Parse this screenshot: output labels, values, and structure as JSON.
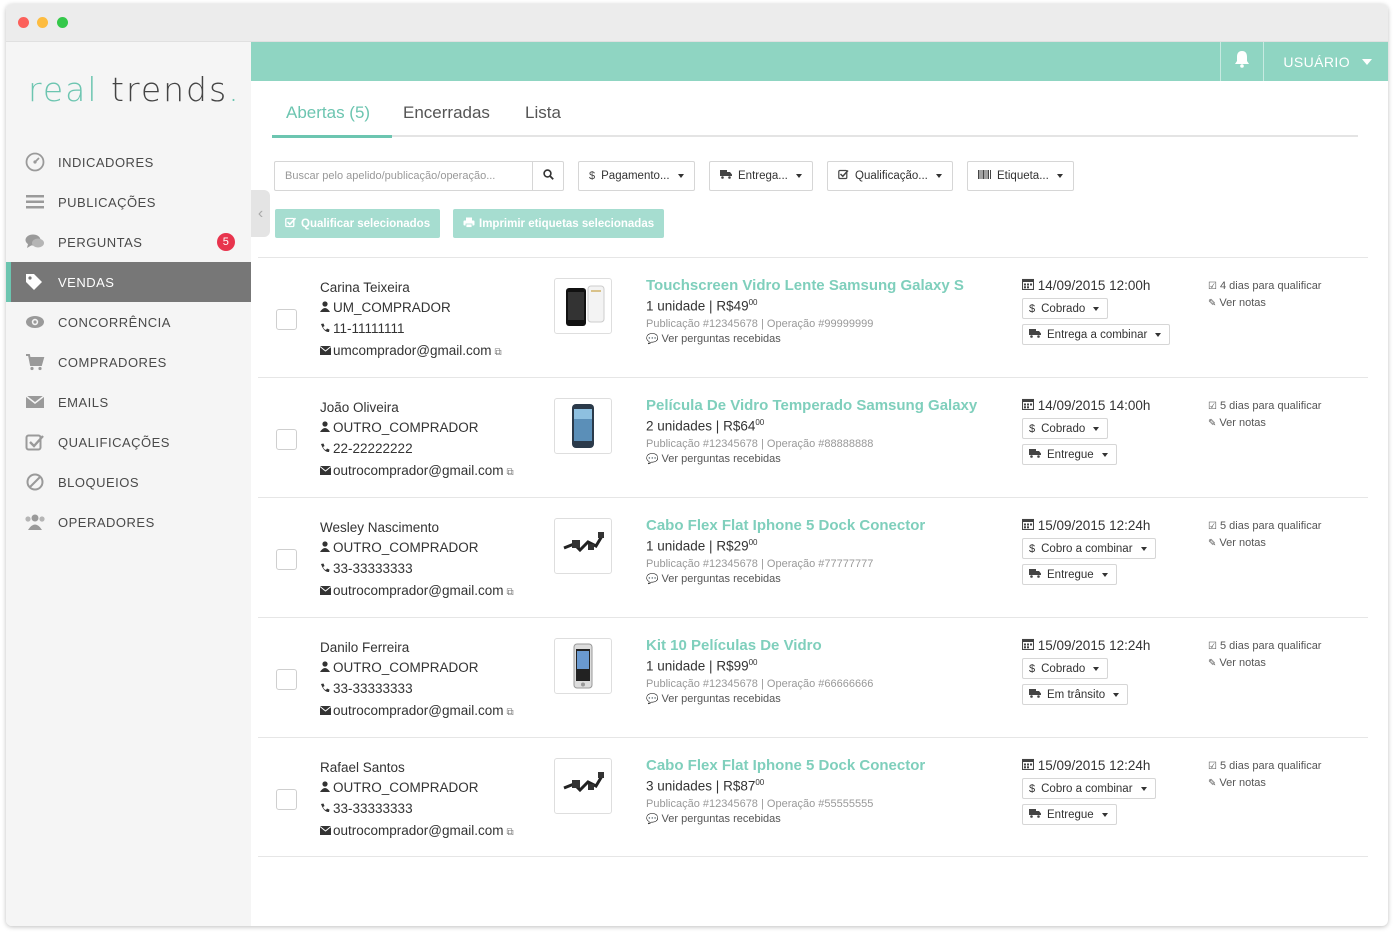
{
  "window": {
    "title_dots": [
      "close",
      "minimize",
      "maximize"
    ]
  },
  "logo": {
    "part1": "real",
    "part2": "trends",
    "part3": "."
  },
  "sidebar": {
    "items": [
      {
        "label": "INDICADORES",
        "icon": "gauge-icon"
      },
      {
        "label": "PUBLICAÇÕES",
        "icon": "list-icon"
      },
      {
        "label": "PERGUNTAS",
        "icon": "comments-icon",
        "badge": "5"
      },
      {
        "label": "VENDAS",
        "icon": "tags-icon",
        "active": true
      },
      {
        "label": "CONCORRÊNCIA",
        "icon": "eye-icon"
      },
      {
        "label": "COMPRADORES",
        "icon": "cart-icon"
      },
      {
        "label": "EMAILS",
        "icon": "envelope-icon"
      },
      {
        "label": "QUALIFICAÇÕES",
        "icon": "check-square-icon"
      },
      {
        "label": "BLOQUEIOS",
        "icon": "ban-icon"
      },
      {
        "label": "OPERADORES",
        "icon": "users-icon"
      }
    ]
  },
  "topbar": {
    "user_label": "USUÁRIO",
    "accent": "#8fd5c2"
  },
  "tabs": {
    "open": "Abertas (5)",
    "closed": "Encerradas",
    "list": "Lista"
  },
  "filters": {
    "search_placeholder": "Buscar pelo apelido/publicação/operação...",
    "payment": "Pagamento...",
    "delivery": "Entrega...",
    "qualification": "Qualificação...",
    "label": "Etiqueta..."
  },
  "actions": {
    "qualify": "Qualificar selecionados",
    "print": "Imprimir etiquetas selecionadas"
  },
  "sales": [
    {
      "buyer_name": "Carina Teixeira",
      "nickname": "UM_COMPRADOR",
      "phone": "11-11111111",
      "email": "umcomprador@gmail.com",
      "thumb": "phone-screen",
      "title": "Touchscreen Vidro Lente Samsung Galaxy S",
      "qty": "1 unidade | R$49",
      "cents": "00",
      "meta": "Publicação #12345678 | Operação #99999999",
      "questions": "Ver perguntas recebidas",
      "date": "14/09/2015 12:00h",
      "payment_status": "Cobrado",
      "delivery_status": "Entrega a combinar",
      "qualify": "4 dias para qualificar",
      "notes": "Ver notas"
    },
    {
      "buyer_name": "João Oliveira",
      "nickname": "OUTRO_COMPRADOR",
      "phone": "22-22222222",
      "email": "outrocomprador@gmail.com",
      "thumb": "galaxy",
      "title": "Película De Vidro Temperado Samsung Galaxy",
      "qty": "2 unidades | R$64",
      "cents": "00",
      "meta": "Publicação #12345678 | Operação #88888888",
      "questions": "Ver perguntas recebidas",
      "date": "14/09/2015 14:00h",
      "payment_status": "Cobrado",
      "delivery_status": "Entregue",
      "qualify": "5 dias para qualificar",
      "notes": "Ver notas"
    },
    {
      "buyer_name": "Wesley Nascimento",
      "nickname": "OUTRO_COMPRADOR",
      "phone": "33-33333333",
      "email": "outrocomprador@gmail.com",
      "thumb": "cable",
      "title": "Cabo Flex Flat Iphone 5 Dock Conector",
      "qty": "1 unidade | R$29",
      "cents": "00",
      "meta": "Publicação #12345678 | Operação #77777777",
      "questions": "Ver perguntas recebidas",
      "date": "15/09/2015 12:24h",
      "payment_status": "Cobro a combinar",
      "delivery_status": "Entregue",
      "qualify": "5 dias para qualificar",
      "notes": "Ver notas"
    },
    {
      "buyer_name": "Danilo Ferreira",
      "nickname": "OUTRO_COMPRADOR",
      "phone": "33-33333333",
      "email": "outrocomprador@gmail.com",
      "thumb": "iphone",
      "title": "Kit 10 Películas De Vidro",
      "qty": "1 unidade | R$99",
      "cents": "00",
      "meta": "Publicação #12345678 | Operação #66666666",
      "questions": "Ver perguntas recebidas",
      "date": "15/09/2015 12:24h",
      "payment_status": "Cobrado",
      "delivery_status": "Em trânsito",
      "qualify": "5 dias para qualificar",
      "notes": "Ver notas"
    },
    {
      "buyer_name": "Rafael Santos",
      "nickname": "OUTRO_COMPRADOR",
      "phone": "33-33333333",
      "email": "outrocomprador@gmail.com",
      "thumb": "cable",
      "title": "Cabo Flex Flat Iphone 5 Dock Conector",
      "qty": "3 unidades | R$87",
      "cents": "00",
      "meta": "Publicação #12345678 | Operação #55555555",
      "questions": "Ver perguntas recebidas",
      "date": "15/09/2015 12:24h",
      "payment_status": "Cobro a combinar",
      "delivery_status": "Entregue",
      "qualify": "5 dias para qualificar",
      "notes": "Ver notas"
    }
  ]
}
